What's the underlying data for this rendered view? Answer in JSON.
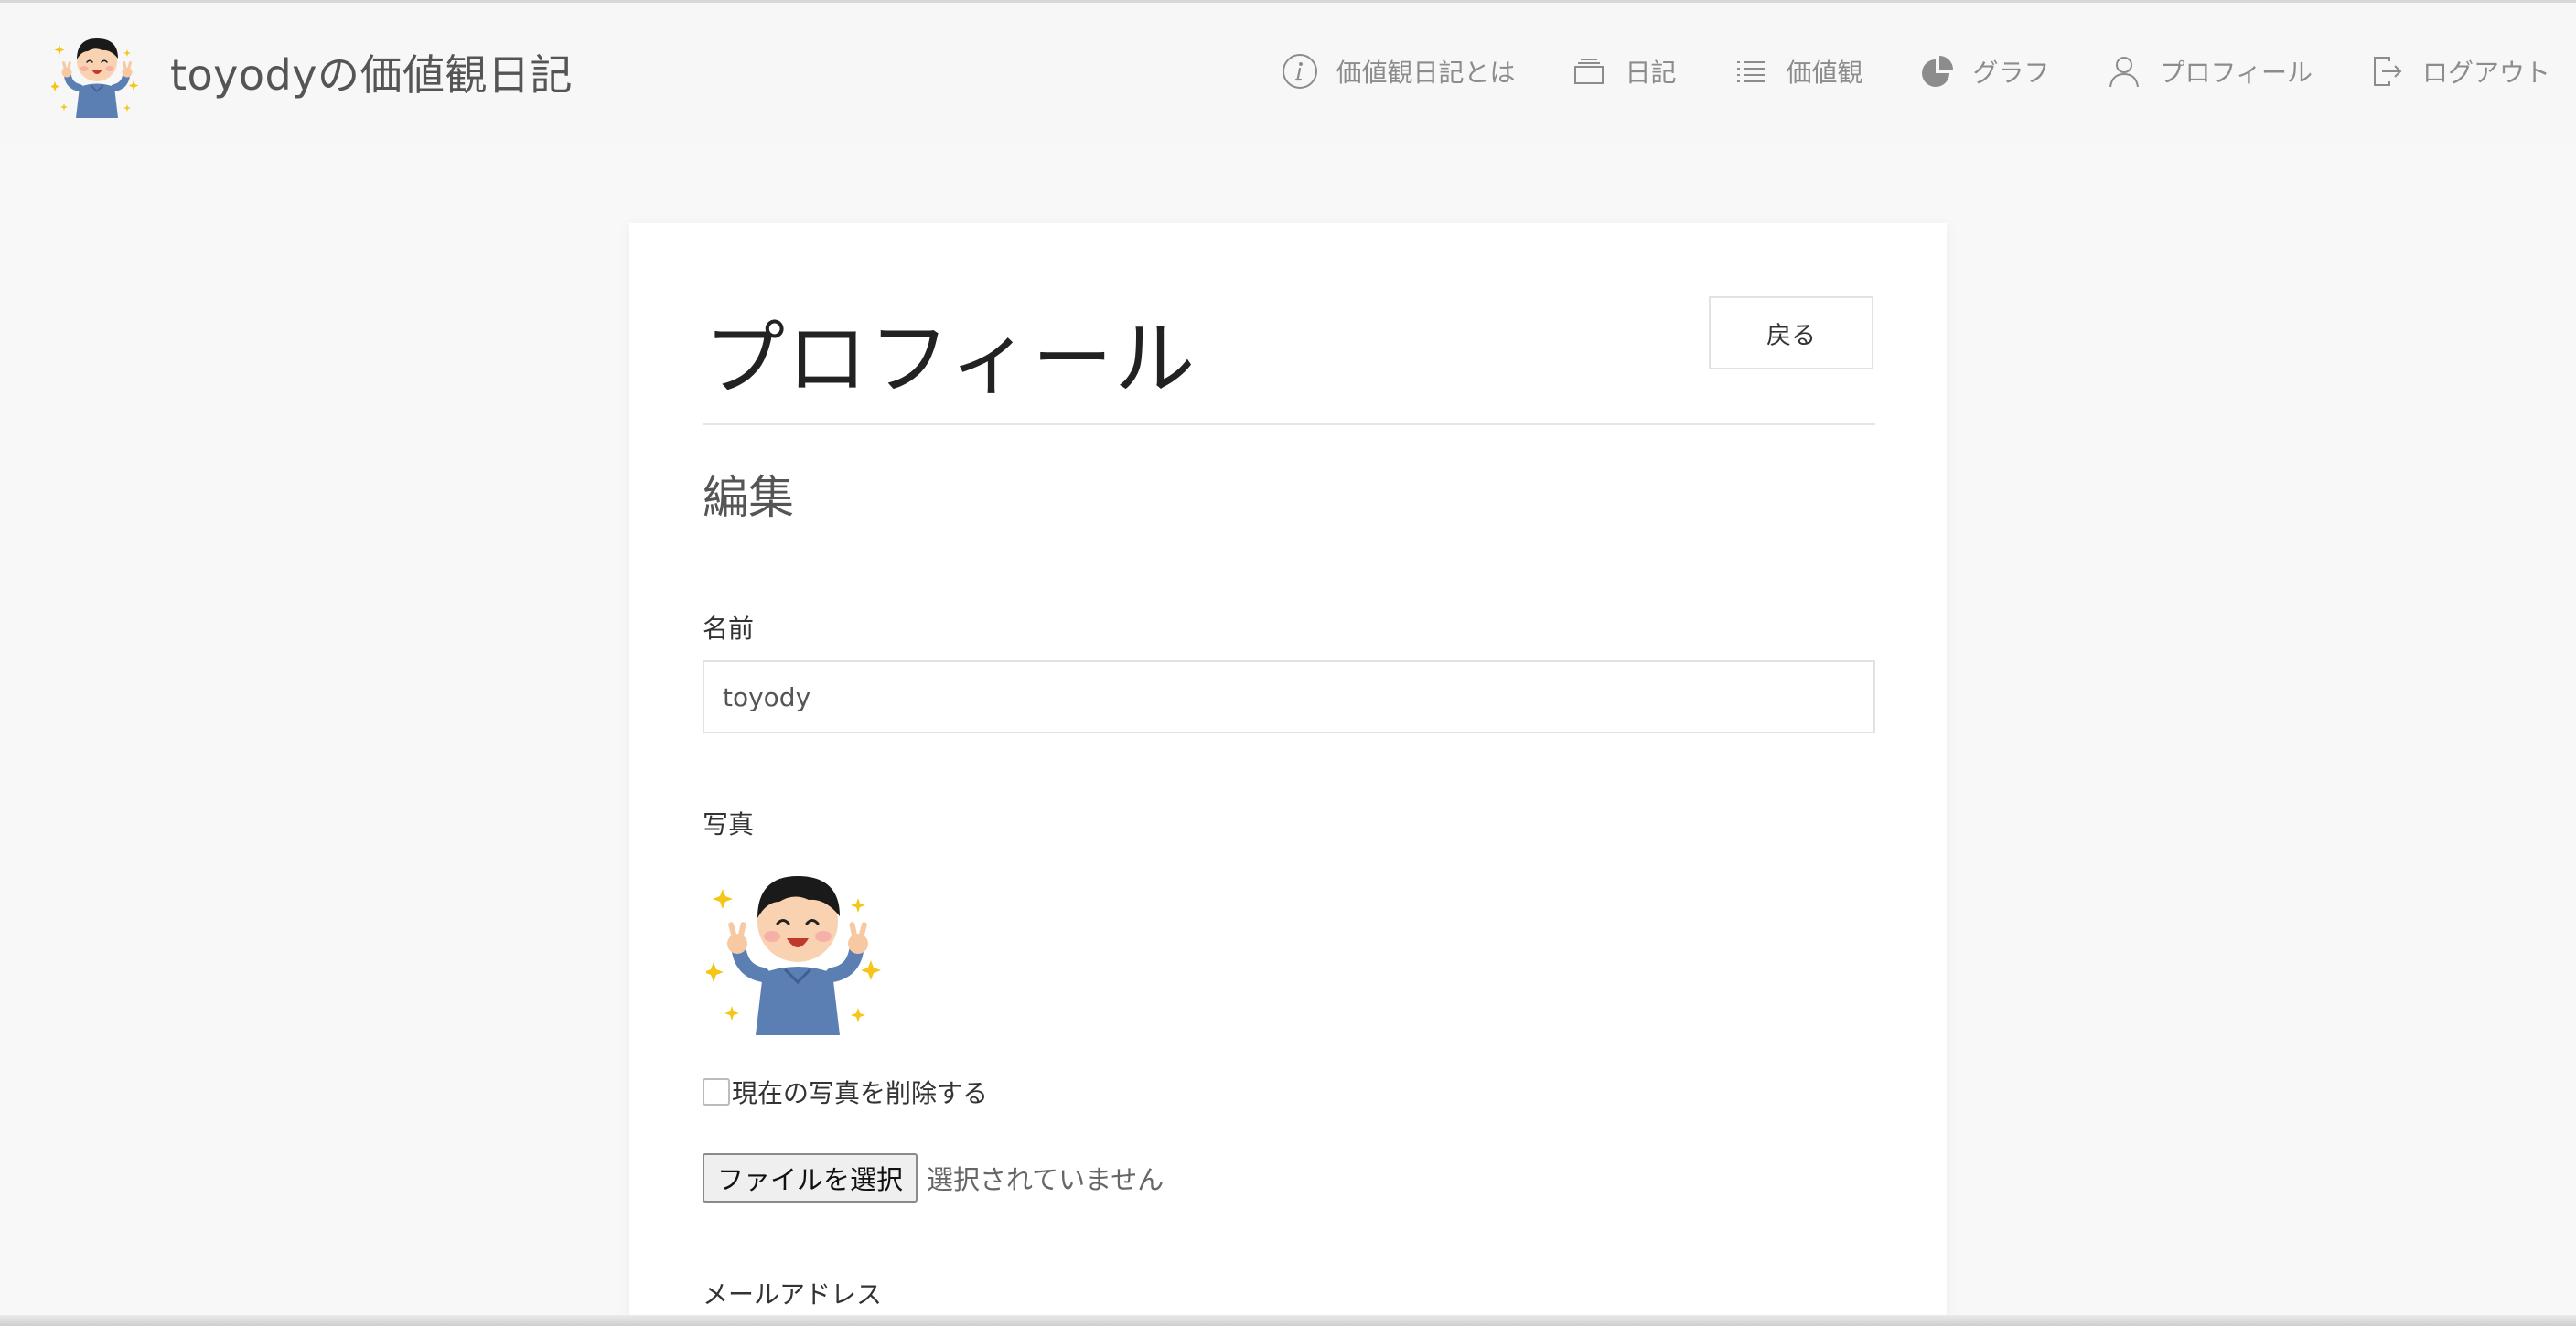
{
  "header": {
    "brand_title": "toyodyの価値観日記",
    "nav": [
      {
        "label": "価値観日記とは",
        "icon": "info-icon"
      },
      {
        "label": "日記",
        "icon": "stack-icon"
      },
      {
        "label": "価値観",
        "icon": "list-icon"
      },
      {
        "label": "グラフ",
        "icon": "pie-chart-icon"
      },
      {
        "label": "プロフィール",
        "icon": "user-icon"
      },
      {
        "label": "ログアウト",
        "icon": "sign-out-icon"
      }
    ]
  },
  "profile": {
    "title": "プロフィール",
    "back_label": "戻る",
    "section_title": "編集",
    "name_label": "名前",
    "name_value": "toyody",
    "photo_label": "写真",
    "delete_photo_label": "現在の写真を削除する",
    "file_button_label": "ファイルを選択",
    "file_status": "選択されていません",
    "email_label": "メールアドレス"
  },
  "colors": {
    "header_bg": "#f7f7f7",
    "page_bg": "#f8f8f9",
    "nav_text": "#8c8c8c",
    "shirt": "#5b7fb3"
  }
}
